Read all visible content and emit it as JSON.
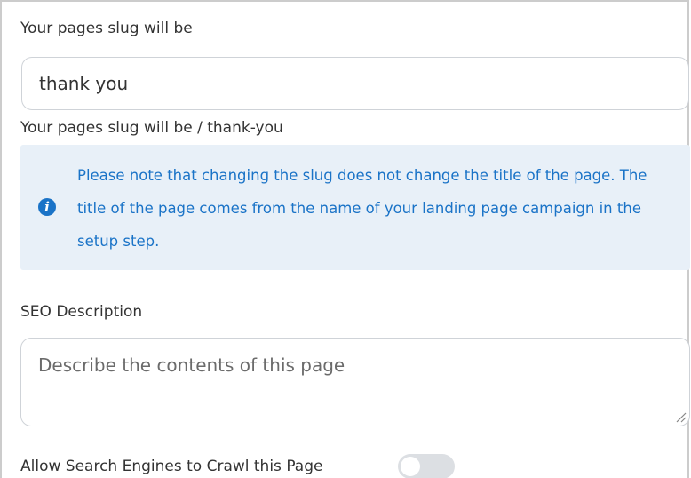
{
  "slug": {
    "label": "Your pages slug will be",
    "value": "thank you",
    "preview": "Your pages slug will be / thank-you"
  },
  "notice": {
    "icon": "info-icon",
    "icon_glyph": "i",
    "text": "Please note that changing the slug does not change the title of the page. The title of the page comes from the name of your landing page campaign in the setup step.",
    "color": "#1a73c7",
    "background": "#e8f0f8"
  },
  "seo": {
    "label": "SEO Description",
    "placeholder": "Describe the contents of this page",
    "value": ""
  },
  "crawl": {
    "label": "Allow Search Engines to Crawl this Page",
    "enabled": false
  }
}
